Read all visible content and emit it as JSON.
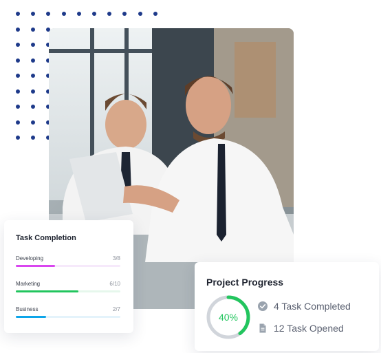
{
  "decor": {
    "dots_icon": "dot-grid-pattern"
  },
  "photo": {
    "icon": "business-meeting-photo"
  },
  "task_completion": {
    "title": "Task Completion",
    "items": [
      {
        "label": "Developing",
        "count": "3/8",
        "fraction": 0.375,
        "color": "#d946ef",
        "track": "#f6e9fb"
      },
      {
        "label": "Marketing",
        "count": "6/10",
        "fraction": 0.6,
        "color": "#22c55e",
        "track": "#e6f7ec"
      },
      {
        "label": "Business",
        "count": "2/7",
        "fraction": 0.29,
        "color": "#0ea5e9",
        "track": "#e4f3fb"
      }
    ]
  },
  "project_progress": {
    "title": "Project Progress",
    "percent_label": "40%",
    "percent": 40,
    "ring_color": "#22c55e",
    "ring_track": "#d1d5db",
    "stats": [
      {
        "icon": "check-circle-icon",
        "text": "4 Task Completed"
      },
      {
        "icon": "document-icon",
        "text": "12 Task Opened"
      }
    ]
  }
}
